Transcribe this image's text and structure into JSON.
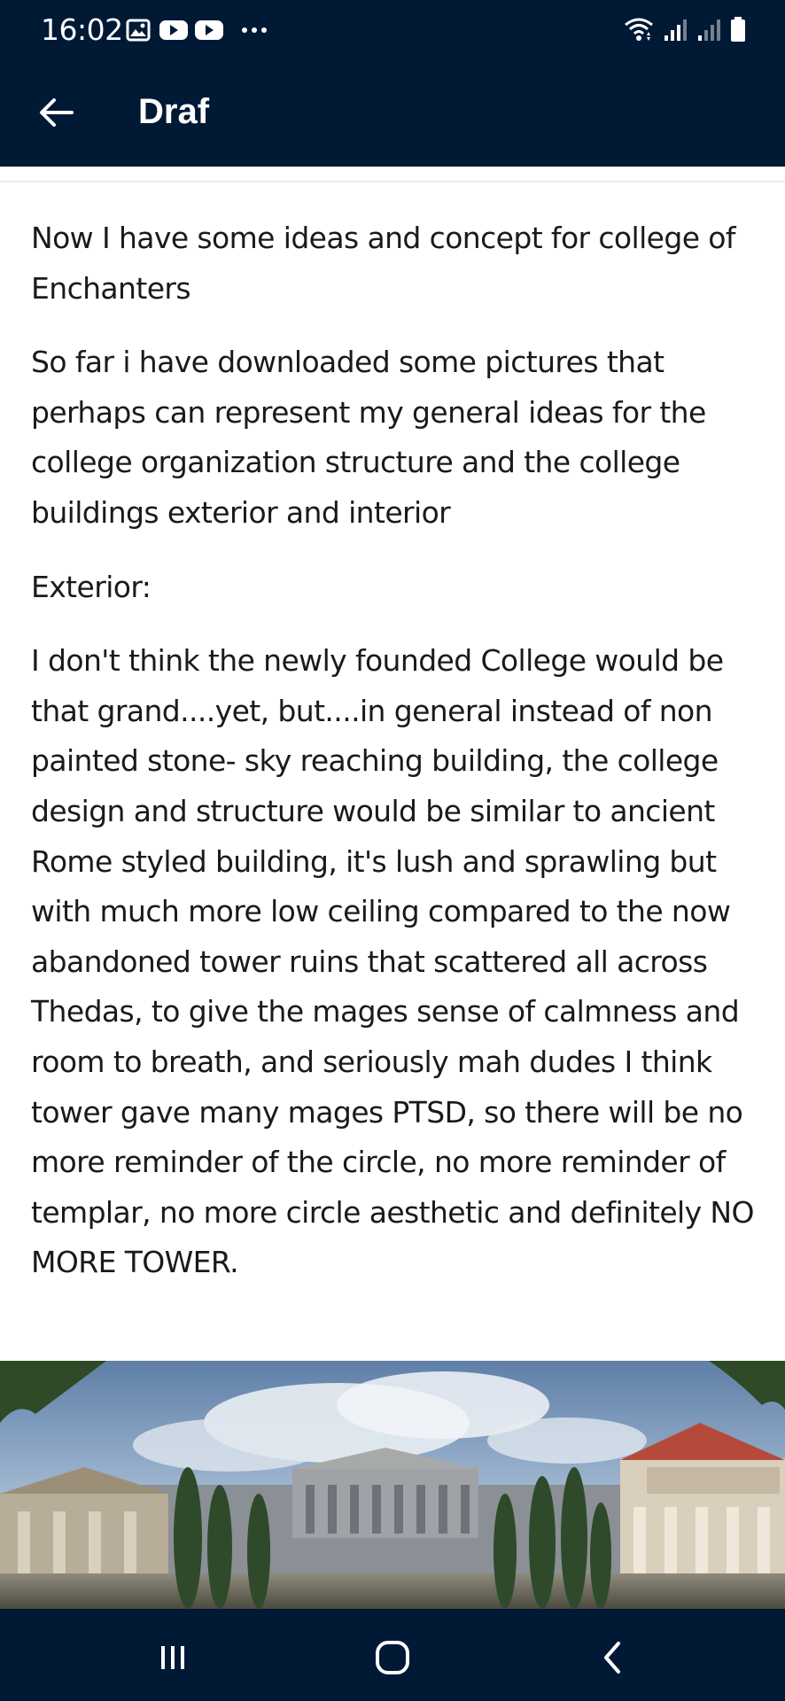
{
  "status_bar": {
    "time": "16:02",
    "notification_icons": [
      "gallery-icon",
      "youtube-icon",
      "youtube-icon",
      "more-notifications-icon"
    ],
    "system_icons": [
      "wifi-icon",
      "signal-icon",
      "signal-icon",
      "battery-icon"
    ]
  },
  "app_bar": {
    "title": "Draf",
    "back_icon": "arrow-left-icon"
  },
  "content": {
    "paragraphs": [
      " Now I have some ideas and concept for college of Enchanters",
      "So far i have downloaded some pictures that perhaps can represent my general ideas for the college organization structure and the college buildings exterior and interior",
      "Exterior:",
      "I don't think the newly founded College would be that grand....yet, but....in general instead of non painted stone- sky reaching building, the college design and structure would be similar to ancient Rome styled building, it's lush and sprawling but with much more low ceiling compared to the now abandoned tower ruins that scattered all across Thedas, to give the mages sense of calmness and room to breath, and seriously mah dudes I think tower gave many mages PTSD, so there will be no more reminder of the circle, no more reminder of templar, no more circle aesthetic and definitely NO MORE TOWER."
    ]
  },
  "image": {
    "subject": "ancient-rome-buildings-image"
  },
  "nav_bar": {
    "buttons": [
      "recent-apps-icon",
      "home-icon",
      "back-icon"
    ]
  },
  "colors": {
    "bar_background": "#001935",
    "text": "#1a1a1a",
    "background": "#ffffff"
  }
}
